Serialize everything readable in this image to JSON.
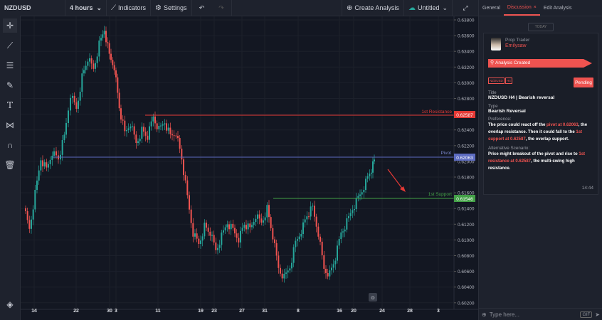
{
  "topbar": {
    "symbol": "NZDUSD",
    "timeframe": "4 hours",
    "indicators": "Indicators",
    "settings": "Settings",
    "create_analysis": "Create Analysis",
    "layout_name": "Untitled"
  },
  "toolbar": {
    "icons": [
      "crosshair-icon",
      "trend-line-icon",
      "horizontal-lines-icon",
      "brush-icon",
      "text-icon",
      "pattern-icon",
      "magnet-icon",
      "trash-icon",
      "layers-icon"
    ]
  },
  "chart": {
    "price_levels": [
      "0.63800",
      "0.63600",
      "0.63400",
      "0.63200",
      "0.63000",
      "0.62800",
      "0.62600",
      "0.62400",
      "0.62200",
      "0.62000",
      "0.61800",
      "0.61600",
      "0.61400",
      "0.61200",
      "0.61000",
      "0.60800",
      "0.60600",
      "0.60400",
      "0.60200"
    ],
    "x_labels": [
      "14",
      "22",
      "30",
      "3",
      "11",
      "19",
      "23",
      "27",
      "31",
      "8",
      "16",
      "20",
      "24",
      "28",
      "3"
    ],
    "resistance_label": "1st Resistance",
    "resistance_value": "0.62587",
    "pivot_label": "Pivot",
    "pivot_value": "0.62063",
    "support_label": "1st Support",
    "support_value": "0.61546",
    "colors": {
      "resistance": "#e53935",
      "pivot": "#5c6bc0",
      "support": "#43a047",
      "bull": "#26a69a",
      "bear": "#ef5350"
    }
  },
  "panel": {
    "tabs": [
      "General",
      "Discussion",
      "Edit Analysis"
    ],
    "today": "TODAY",
    "author_role": "Prop Trader",
    "author_name": "Emilysaw",
    "status_banner": "Analysis Created",
    "symbol_tag": "NZDUSD",
    "tf_tag": "H4",
    "pending": "Pending",
    "title_label": "Title",
    "title_value": "NZDUSD H4 | Bearish reversal",
    "type_label": "Type",
    "type_value": "Bearish Reversal",
    "pref_label": "Preference:",
    "pref_p1": "The price could react off the ",
    "pref_h1": "pivot at 0.62063",
    "pref_p2": ", the overlap resistance. Then it could fall to the ",
    "pref_h2": "1st support at 0.62587",
    "pref_p3": ", the overlap support.",
    "alt_label": "Alternative Scenario:",
    "alt_p1": "Price might breakout of the pivot and rise to ",
    "alt_h1": "1st resistance at 0.62587",
    "alt_p2": ", the multi-swing high resistance.",
    "time": "14:44",
    "input_placeholder": "Type here...",
    "gif": "GIF"
  }
}
